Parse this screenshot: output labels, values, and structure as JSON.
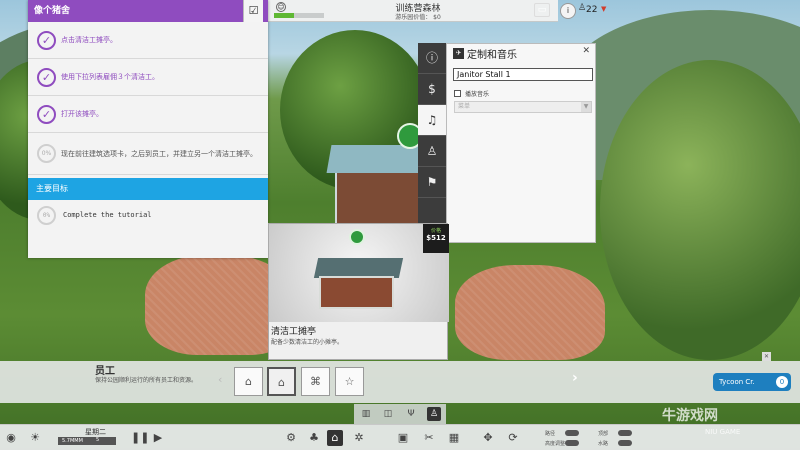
{
  "topbar": {
    "park_name": "训练营森林",
    "park_value_label": "游乐园价值：",
    "park_value": "$0",
    "rating_fraction": 0.4,
    "info_label": "i",
    "guest_count": "22",
    "trend_icon": "▼"
  },
  "objectives": {
    "title": "像个猪舍",
    "tasks": [
      {
        "text": "点击清洁工摊亭。",
        "state": "done"
      },
      {
        "text": "使用下拉列表雇佣３个清洁工。",
        "state": "done"
      },
      {
        "text": "打开该摊亭。",
        "state": "done"
      },
      {
        "text": "现在前往建筑选项卡，之后到员工，并建立另一个清洁工摊亭。",
        "state": "pending",
        "pct": "0%"
      }
    ],
    "goal_header": "主要目标",
    "goal": {
      "text": "Complete the tutorial",
      "pct": "0%"
    }
  },
  "music_panel": {
    "title": "定制和音乐",
    "stall_name": "Janitor Stall 1",
    "play_music_label": "播放音乐",
    "music_select": "菜单",
    "tabs": [
      "info",
      "dollar",
      "music",
      "staff",
      "flag"
    ]
  },
  "preview": {
    "price_label": "价格",
    "price": "$512",
    "title": "清洁工摊亭",
    "desc": "配备少数清洁工的小摊亭。"
  },
  "staff_bar": {
    "title": "员工",
    "desc": "保持公园顺利运行的所有员工和资源。",
    "items": [
      "janitor-stall",
      "mechanic-stall",
      "security-stall",
      "entertainer-stall"
    ],
    "tycoon_label": "Tycoon Cr.",
    "tycoon_count": "0"
  },
  "bottombar": {
    "day": "星期二",
    "time": "5.7MMM",
    "speed": "5",
    "toggle1_label": "路径",
    "toggle2_label": "高度调整",
    "toggle3_label": "顶部",
    "toggle4_label": "水路"
  },
  "watermark": {
    "main": "牛游戏网",
    "sub": "NIU GAME"
  }
}
